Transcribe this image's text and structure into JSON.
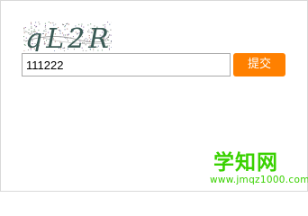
{
  "captcha": {
    "text": "qL2R",
    "icon": "captcha-image"
  },
  "form": {
    "input_value": "111222",
    "submit_label": "提交"
  },
  "watermark": {
    "title": "学知网",
    "url": "www.jmqz1000.com"
  },
  "colors": {
    "submit_bg": "#ff8000",
    "submit_text": "#ffffff",
    "watermark_green": "#39d100",
    "input_border": "#a9a9a9",
    "frame_border": "#d9d9d9"
  }
}
